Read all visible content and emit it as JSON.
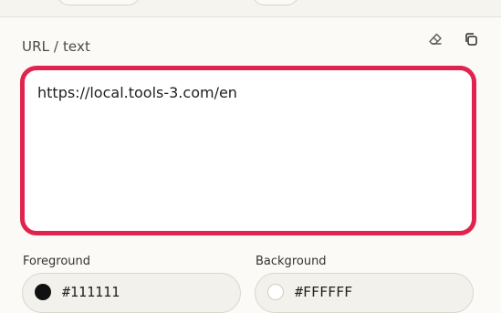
{
  "panel": {
    "label": "URL / text",
    "value": "https://local.tools-3.com/en"
  },
  "icons": {
    "clear": "eraser-icon",
    "copy": "copy-icon"
  },
  "foreground": {
    "label": "Foreground",
    "value": "#111111",
    "color": "#111111"
  },
  "background": {
    "label": "Background",
    "value": "#FFFFFF",
    "color": "#FFFFFF"
  },
  "colors": {
    "focus_border": "#e0244f"
  }
}
